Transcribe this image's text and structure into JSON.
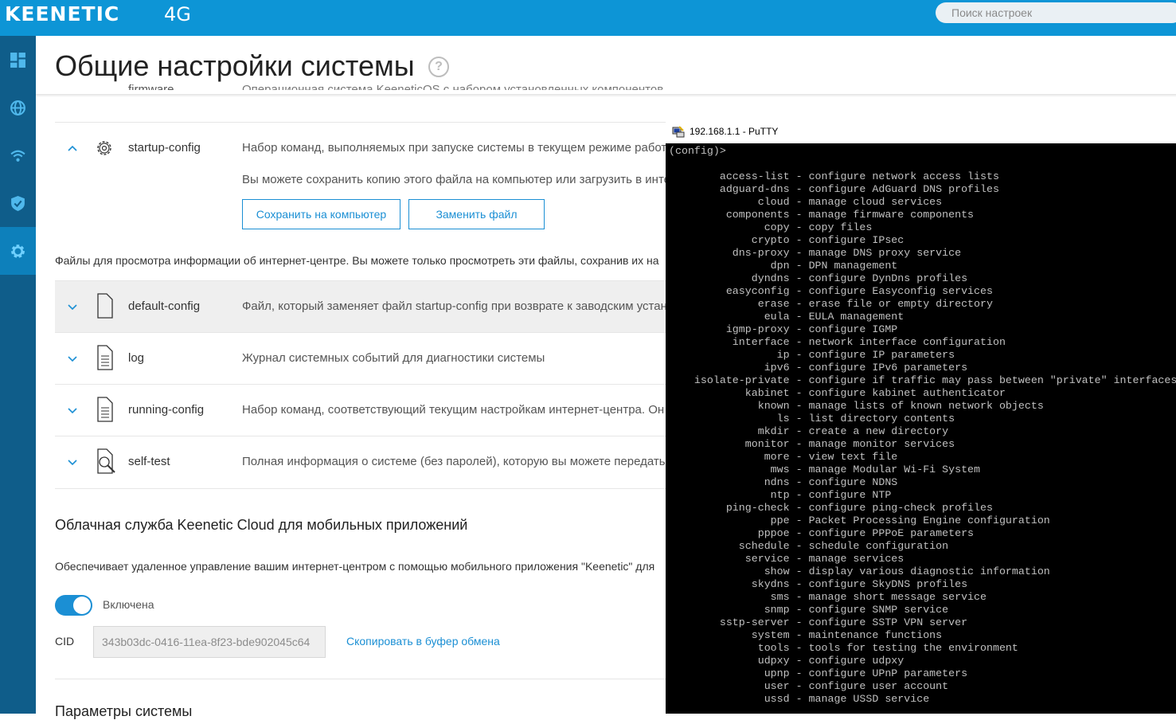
{
  "header": {
    "logo": "KEENETIC",
    "model": "4G",
    "search_placeholder": "Поиск настроек"
  },
  "sidebar": {
    "items": [
      {
        "name": "dashboard",
        "active": false
      },
      {
        "name": "internet",
        "active": false
      },
      {
        "name": "wifi",
        "active": false
      },
      {
        "name": "security",
        "active": false
      },
      {
        "name": "settings",
        "active": true
      }
    ]
  },
  "page": {
    "title": "Общие настройки системы",
    "help": "?"
  },
  "files": {
    "partial_row": {
      "name": "firmware",
      "desc": "Операционная система KeeneticOS с набором установленных компонентов."
    },
    "startup": {
      "name": "startup-config",
      "desc": "Набор команд, выполняемых при запуске системы в текущем режиме работы",
      "note": "Вы можете сохранить копию этого файла на компьютер или загрузить в интерне",
      "save_button": "Сохранить на компьютер",
      "replace_button": "Заменить файл"
    },
    "info_text": "Файлы для просмотра информации об интернет-центре. Вы можете только просмотреть эти файлы, сохранив их на",
    "list": [
      {
        "name": "default-config",
        "desc": "Файл, который заменяет файл startup-config при возврате к заводским установк"
      },
      {
        "name": "log",
        "desc": "Журнал системных событий для диагностики системы"
      },
      {
        "name": "running-config",
        "desc": "Набор команд, соответствующий текущим настройкам интернет-центра. Он заме"
      },
      {
        "name": "self-test",
        "desc": "Полная информация о системе (без паролей), которую вы можете передать по э"
      }
    ]
  },
  "cloud": {
    "heading": "Облачная служба Keenetic Cloud для мобильных приложений",
    "desc": "Обеспечивает удаленное управление вашим интернет-центром с помощью мобильного приложения \"Keenetic\" для",
    "toggle_label": "Включена",
    "toggle_on": true,
    "cid_label": "CID",
    "cid_value": "343b03dc-0416-11ea-8f23-bde902045c64",
    "copy_link": "Скопировать в буфер обмена"
  },
  "next_section": "Параметры системы",
  "putty": {
    "title": "192.168.1.1 - PuTTY",
    "prompt": "(config)>",
    "commands": [
      {
        "cmd": "access-list",
        "desc": "configure network access lists"
      },
      {
        "cmd": "adguard-dns",
        "desc": "configure AdGuard DNS profiles"
      },
      {
        "cmd": "cloud",
        "desc": "manage cloud services"
      },
      {
        "cmd": "components",
        "desc": "manage firmware components"
      },
      {
        "cmd": "copy",
        "desc": "copy files"
      },
      {
        "cmd": "crypto",
        "desc": "configure IPsec"
      },
      {
        "cmd": "dns-proxy",
        "desc": "manage DNS proxy service"
      },
      {
        "cmd": "dpn",
        "desc": "DPN management"
      },
      {
        "cmd": "dyndns",
        "desc": "configure DynDns profiles"
      },
      {
        "cmd": "easyconfig",
        "desc": "configure Easyconfig services"
      },
      {
        "cmd": "erase",
        "desc": "erase file or empty directory"
      },
      {
        "cmd": "eula",
        "desc": "EULA management"
      },
      {
        "cmd": "igmp-proxy",
        "desc": "configure IGMP"
      },
      {
        "cmd": "interface",
        "desc": "network interface configuration"
      },
      {
        "cmd": "ip",
        "desc": "configure IP parameters"
      },
      {
        "cmd": "ipv6",
        "desc": "configure IPv6 parameters"
      },
      {
        "cmd": "isolate-private",
        "desc": "configure if traffic may pass between \"private\" interfaces"
      },
      {
        "cmd": "kabinet",
        "desc": "configure kabinet authenticator"
      },
      {
        "cmd": "known",
        "desc": "manage lists of known network objects"
      },
      {
        "cmd": "ls",
        "desc": "list directory contents"
      },
      {
        "cmd": "mkdir",
        "desc": "create a new directory"
      },
      {
        "cmd": "monitor",
        "desc": "manage monitor services"
      },
      {
        "cmd": "more",
        "desc": "view text file"
      },
      {
        "cmd": "mws",
        "desc": "manage Modular Wi-Fi System"
      },
      {
        "cmd": "ndns",
        "desc": "configure NDNS"
      },
      {
        "cmd": "ntp",
        "desc": "configure NTP"
      },
      {
        "cmd": "ping-check",
        "desc": "configure ping-check profiles"
      },
      {
        "cmd": "ppe",
        "desc": "Packet Processing Engine configuration"
      },
      {
        "cmd": "pppoe",
        "desc": "configure PPPoE parameters"
      },
      {
        "cmd": "schedule",
        "desc": "schedule configuration"
      },
      {
        "cmd": "service",
        "desc": "manage services"
      },
      {
        "cmd": "show",
        "desc": "display various diagnostic information"
      },
      {
        "cmd": "skydns",
        "desc": "configure SkyDNS profiles"
      },
      {
        "cmd": "sms",
        "desc": "manage short message service"
      },
      {
        "cmd": "snmp",
        "desc": "configure SNMP service"
      },
      {
        "cmd": "sstp-server",
        "desc": "configure SSTP VPN server"
      },
      {
        "cmd": "system",
        "desc": "maintenance functions"
      },
      {
        "cmd": "tools",
        "desc": "tools for testing the environment"
      },
      {
        "cmd": "udpxy",
        "desc": "configure udpxy"
      },
      {
        "cmd": "upnp",
        "desc": "configure UPnP parameters"
      },
      {
        "cmd": "user",
        "desc": "configure user account"
      },
      {
        "cmd": "ussd",
        "desc": "manage USSD service"
      }
    ]
  },
  "colors": {
    "header": "#0d95d6",
    "sidebar": "#0f5d8a",
    "accent": "#1b8fd4",
    "terminal_bg": "#000000",
    "terminal_fg": "#c0c0c0"
  }
}
